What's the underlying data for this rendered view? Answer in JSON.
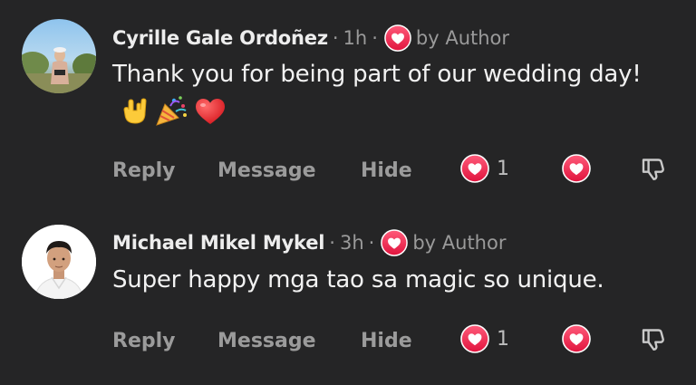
{
  "comments": [
    {
      "author": "Cyrille Gale Ordoñez",
      "time": "1h",
      "liked_by": "by Author",
      "text": "Thank you for being part of our wedding day!",
      "emojis": [
        "love-you-gesture-emoji",
        "party-popper-emoji",
        "red-heart-emoji"
      ],
      "actions": {
        "reply": "Reply",
        "message": "Message",
        "hide": "Hide"
      },
      "reaction_count": "1"
    },
    {
      "author": "Michael Mikel Mykel",
      "time": "3h",
      "liked_by": "by Author",
      "text": "Super happy mga tao sa magic so unique.",
      "emojis": [],
      "actions": {
        "reply": "Reply",
        "message": "Message",
        "hide": "Hide"
      },
      "reaction_count": "1"
    }
  ],
  "colors": {
    "background": "#252526",
    "heart_gradient_start": "#ff5573",
    "heart_gradient_end": "#e3163f",
    "muted_text": "#9a9a9a"
  }
}
